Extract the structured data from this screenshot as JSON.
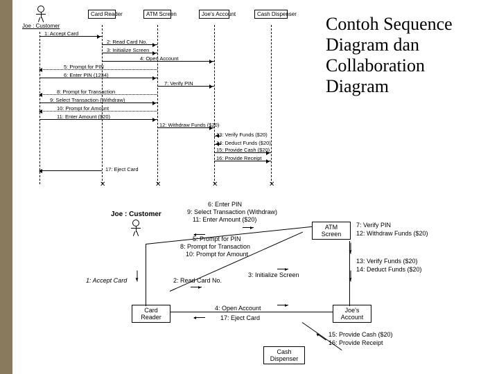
{
  "title": "Contoh Sequence Diagram dan Collaboration Diagram",
  "seq": {
    "actor": "Joe : Customer",
    "lifelines": [
      "Card Reader",
      "ATM Screen",
      "Joe's Account",
      "Cash Dispenser"
    ],
    "messages": [
      "1: Accept Card",
      "2: Read Card No.",
      "3: Initialize Screen",
      "4: Open Account",
      "5: Prompt for PIN",
      "6: Enter PIN (1234)",
      "7: Verify PIN",
      "8: Prompt for Transaction",
      "9: Select Transaction (Withdraw)",
      "10: Prompt for Amount",
      "11: Enter Amount ($20)",
      "12: Withdraw Funds ($20)",
      "13: Verify Funds ($20)",
      "14: Deduct Funds ($20)",
      "15: Provide Cash ($20)",
      "16: Provide Receipt",
      "17: Eject Card"
    ]
  },
  "collab": {
    "actor": "Joe : Customer",
    "nodes": [
      "ATM Screen",
      "Card Reader",
      "Joe's Account",
      "Cash Dispenser"
    ],
    "edges": [
      "1: Accept Card",
      "2: Read Card No.",
      "3: Initialize Screen",
      "4: Open Account",
      "5: Prompt for PIN",
      "6: Enter PIN",
      "7: Verify PIN",
      "8: Prompt for Transaction",
      "9: Select Transaction (Withdraw)",
      "10: Prompt for Amount",
      "11: Enter Amount ($20)",
      "12: Withdraw Funds ($20)",
      "13: Verify Funds ($20)",
      "14: Deduct Funds ($20)",
      "15: Provide Cash ($20)",
      "16: Provide Receipt",
      "17: Eject Card"
    ]
  }
}
